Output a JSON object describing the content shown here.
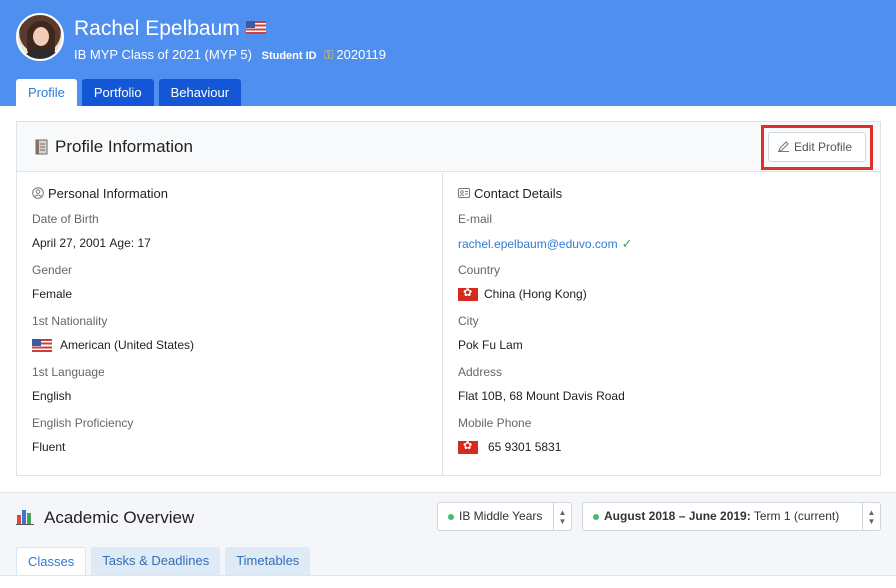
{
  "student": {
    "name": "Rachel Epelbaum",
    "program": "IB MYP Class of 2021 (MYP 5)",
    "student_id_label": "Student ID",
    "student_id": "2020119"
  },
  "tabs": [
    "Profile",
    "Portfolio",
    "Behaviour"
  ],
  "profile_card": {
    "title": "Profile Information",
    "edit_label": "Edit Profile"
  },
  "personal": {
    "heading": "Personal Information",
    "dob_label": "Date of Birth",
    "dob_value": "April 27, 2001",
    "age_label": "Age:",
    "age_value": "17",
    "gender_label": "Gender",
    "gender_value": "Female",
    "nationality_label": "1st Nationality",
    "nationality_value": "American (United States)",
    "language_label": "1st Language",
    "language_value": "English",
    "proficiency_label": "English Proficiency",
    "proficiency_value": "Fluent"
  },
  "contact": {
    "heading": "Contact Details",
    "email_label": "E-mail",
    "email_value": "rachel.epelbaum@eduvo.com",
    "country_label": "Country",
    "country_value": "China (Hong Kong)",
    "city_label": "City",
    "city_value": "Pok Fu Lam",
    "address_label": "Address",
    "address_value": "Flat 10B, 68 Mount Davis Road",
    "phone_label": "Mobile Phone",
    "phone_value": "65 9301 5831"
  },
  "academic": {
    "title": "Academic Overview",
    "program_select": "IB Middle Years",
    "term_range": "August 2018 – June 2019:",
    "term_value": "Term 1 (current)",
    "subtabs": [
      "Classes",
      "Tasks & Deadlines",
      "Timetables"
    ]
  },
  "colors": {
    "header_bg": "#4f8ff0",
    "tab_inactive": "#1357d6",
    "link": "#2f7bd6",
    "highlight_outline": "#e12d2b",
    "status_dot": "#3bbf6a"
  }
}
